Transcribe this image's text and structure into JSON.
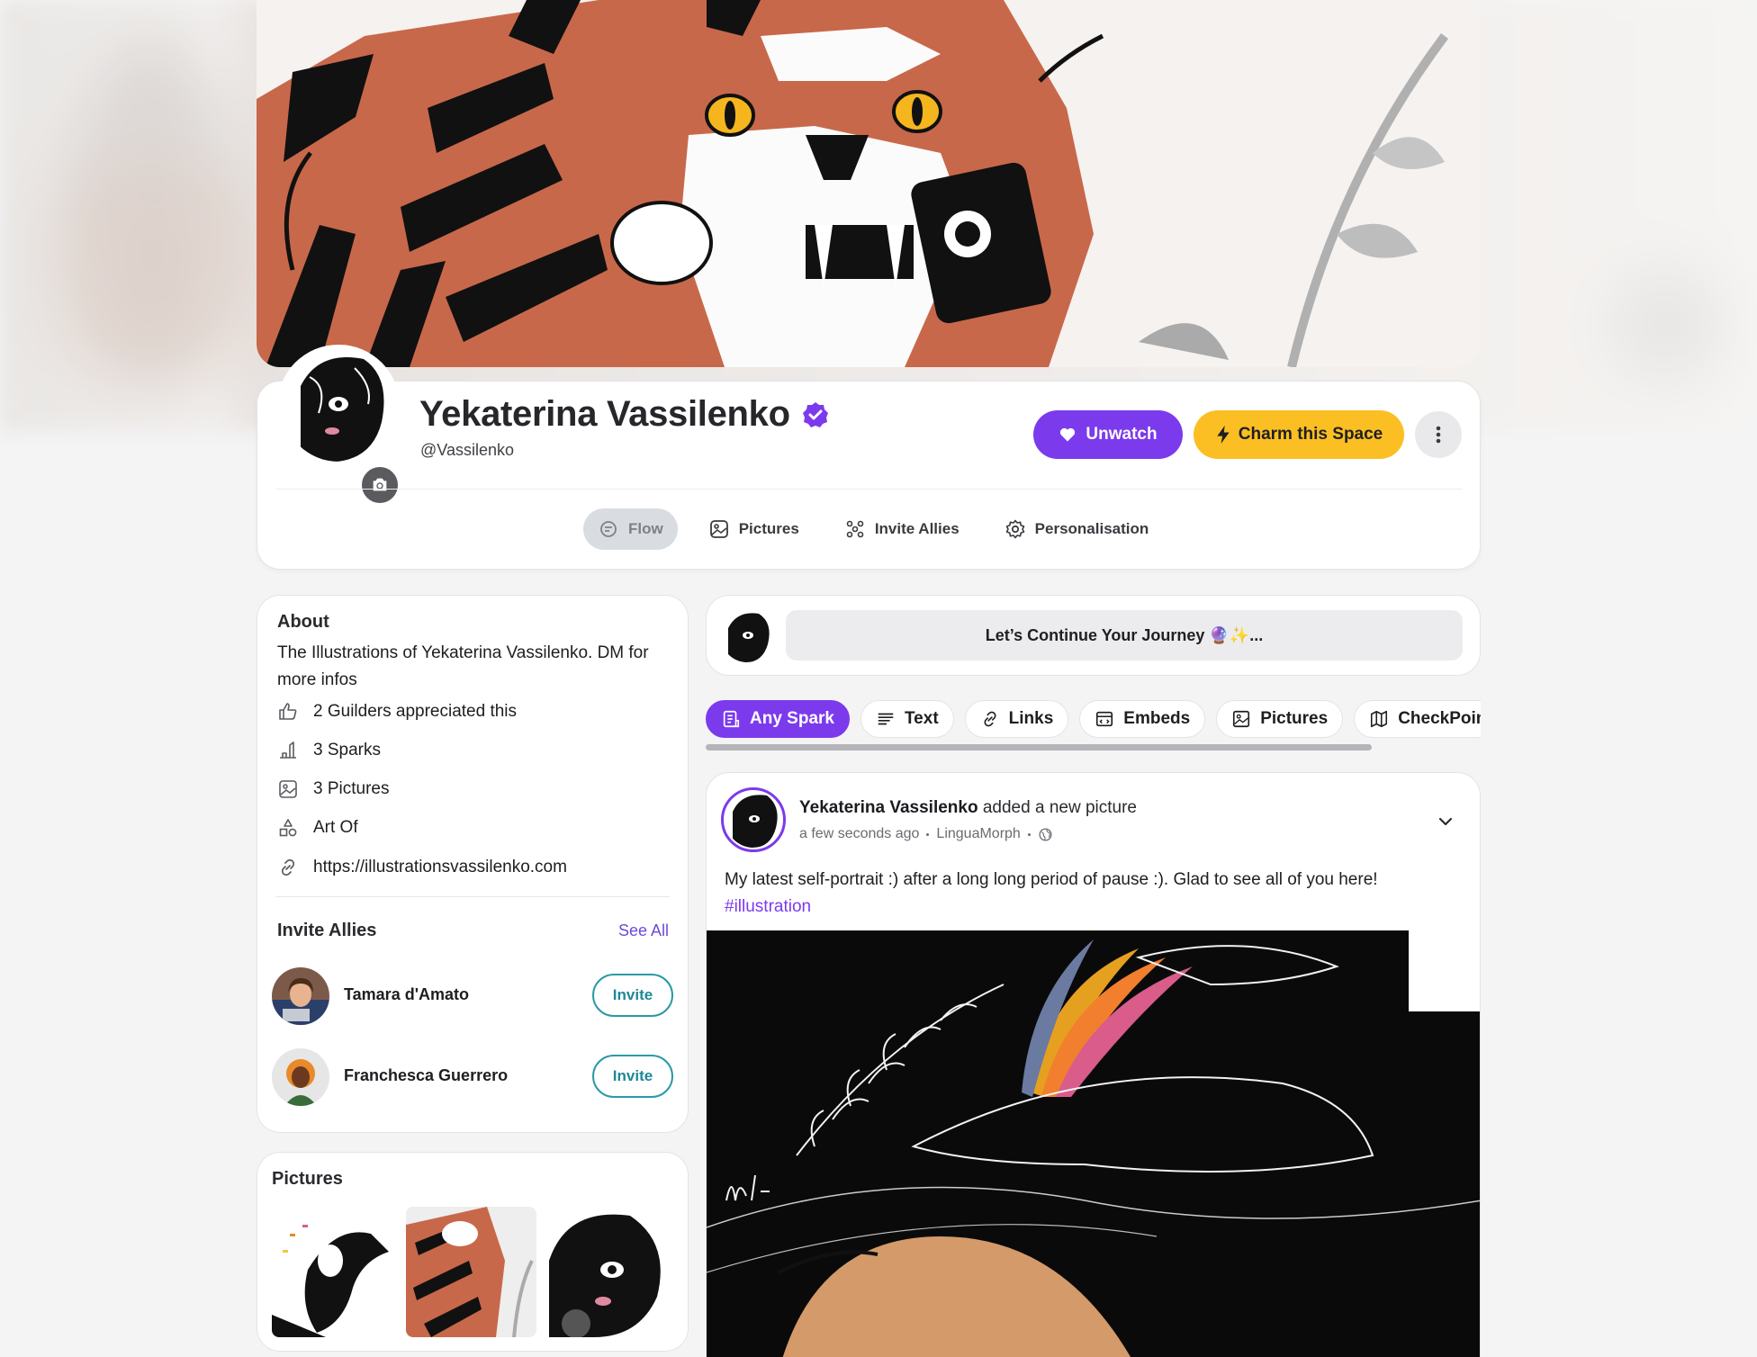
{
  "profile": {
    "name": "Yekaterina Vassilenko",
    "handle": "@Vassilenko",
    "buttons": {
      "unwatch": "Unwatch",
      "charm": "Charm this Space"
    },
    "tabs": [
      {
        "label": "Flow",
        "icon": "flow-icon",
        "active": true
      },
      {
        "label": "Pictures",
        "icon": "image-icon"
      },
      {
        "label": "Invite Allies",
        "icon": "people-icon"
      },
      {
        "label": "Personalisation",
        "icon": "gear-icon"
      }
    ]
  },
  "about": {
    "title": "About",
    "description": "The Illustrations of Yekaterina Vassilenko. DM for more infos",
    "stats": [
      {
        "icon": "thumbs-up-icon",
        "text": "2 Guilders appreciated this"
      },
      {
        "icon": "spark-icon",
        "text": "3 Sparks"
      },
      {
        "icon": "image-icon",
        "text": "3 Pictures"
      },
      {
        "icon": "shapes-icon",
        "text": "Art Of"
      },
      {
        "icon": "link-icon",
        "text": "https://illustrationsvassilenko.com"
      }
    ]
  },
  "allies": {
    "title": "Invite Allies",
    "see_all": "See All",
    "people": [
      {
        "name": "Tamara d'Amato",
        "action": "Invite"
      },
      {
        "name": "Franchesca Guerrero",
        "action": "Invite"
      }
    ]
  },
  "pictures": {
    "title": "Pictures"
  },
  "composer": {
    "prompt": "Let’s Continue Your Journey 🔮✨..."
  },
  "filters": [
    {
      "label": "Any Spark",
      "icon": "document-icon",
      "active": true
    },
    {
      "label": "Text",
      "icon": "text-lines-icon"
    },
    {
      "label": "Links",
      "icon": "link-icon"
    },
    {
      "label": "Embeds",
      "icon": "embed-icon"
    },
    {
      "label": "Pictures",
      "icon": "image-icon"
    },
    {
      "label": "CheckPoints",
      "icon": "map-icon"
    }
  ],
  "post": {
    "author": "Yekaterina Vassilenko",
    "action": "added a new picture",
    "time": "a few seconds ago",
    "community": "LinguaMorph",
    "text": "My latest self-portrait :) after a long long period of pause :). Glad to see all of you here!",
    "hashtag": "#illustration"
  },
  "colors": {
    "accent": "#7c3aed",
    "charm": "#fbbf24",
    "invite": "#2a9aa6",
    "link": "#6d4bd8"
  }
}
